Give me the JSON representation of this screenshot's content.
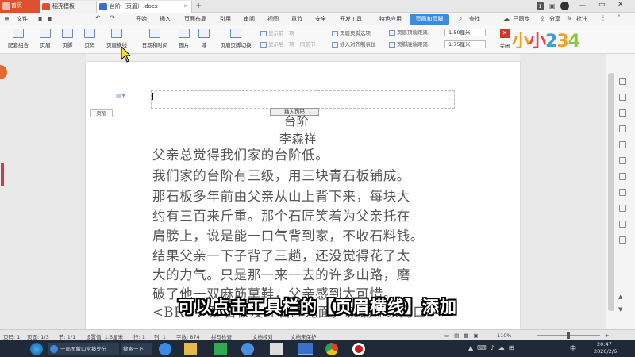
{
  "tabs": {
    "home": "首页",
    "template": "稻壳模板",
    "doc": "台阶（页眉）.docx"
  },
  "titlebar_right": {
    "badge": "1"
  },
  "menu": {
    "file": "文件",
    "items": [
      "开始",
      "插入",
      "页面布局",
      "引用",
      "审阅",
      "视图",
      "章节",
      "安全",
      "开发工具",
      "特色应用",
      "页眉和页脚"
    ],
    "search": "查找",
    "sync": "已同步",
    "share": "分享",
    "comment": "批注"
  },
  "ribbon": {
    "buttons": [
      "配套组合",
      "页眉",
      "页脚",
      "页码",
      "页眉横线",
      "日期和时间",
      "图片",
      "域",
      "页眉页脚切换"
    ],
    "small": {
      "show_prev": "显示前一项",
      "show_next": "显示后一项",
      "same_prev": "同前节",
      "options": "页眉页脚选项",
      "align_tab": "插入对齐制表位",
      "top_dist_label": "页眉顶端距离:",
      "top_dist_value": "1.50厘米",
      "bottom_dist_label": "页脚底端距离:",
      "bottom_dist_value": "1.75厘米",
      "close": "关闭"
    }
  },
  "logo": "小小234",
  "page": {
    "header_tag": "页眉",
    "insert_page_num": "插入页码",
    "title": "台阶",
    "author": "李森祥",
    "lines": [
      "父亲总觉得我们家的台阶低。",
      "我们家的台阶有三级，用三块青石板铺成。",
      "那石板多年前由父亲从山上背下来，每块大",
      "约有三百来斤重。那个石匠笑着为父亲托在",
      "肩膀上，说是能一口气背到家，不收石料钱。",
      "结果父亲一下子背了三趟，还没觉得花了太",
      "大的力气。只是那一来一去的许多山路，磨",
      "破了他一双麻筋草鞋，父亲感到太可惜。",
      "<BR>：那石板没经石匠光面，就铺在家门口"
    ]
  },
  "subtitle": "可以点击工具栏的【页眉横线】添加",
  "status": {
    "page": "页码: 1",
    "pages": "页面: 1/3",
    "section": "节: 1/1",
    "setting": "设置值: 1.5厘米",
    "row": "行: 1",
    "col": "列: 1",
    "words": "字数: 874",
    "spell": "拼写检查",
    "protect": "文档校对",
    "unprotected": "文档未保护",
    "zoom": "110%"
  },
  "taskbar": {
    "app1": "干部图戴口常被处分",
    "app2": "搜索一下",
    "time": "20:47",
    "date": "2020/2/6",
    "lang": "中"
  },
  "colors": {
    "accent": "#3c8be0",
    "home_tab": "#e05030"
  }
}
